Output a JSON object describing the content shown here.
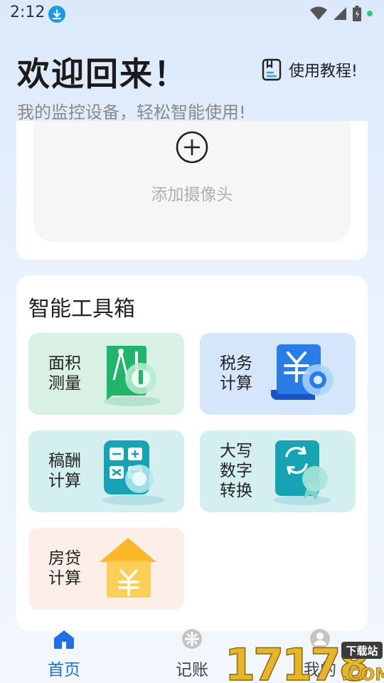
{
  "status_bar": {
    "time": "2:12",
    "icons": [
      "download-icon",
      "wifi-icon",
      "signal-icon",
      "battery-icon",
      "notification-dot-icon"
    ]
  },
  "header": {
    "title": "欢迎回来！",
    "subtitle": "我的监控设备，轻松智能使用!",
    "tutorial_label": "使用教程!"
  },
  "camera": {
    "add_label": "添加摄像头"
  },
  "toolbox": {
    "title": "智能工具箱",
    "tools": [
      {
        "lines": [
          "面积",
          "测量"
        ],
        "icon": "ruler-compass-icon"
      },
      {
        "lines": [
          "税务",
          "计算"
        ],
        "icon": "yuan-document-icon"
      },
      {
        "lines": [
          "稿酬",
          "计算"
        ],
        "icon": "calculator-icon"
      },
      {
        "lines": [
          "大写",
          "数字",
          "转换"
        ],
        "icon": "certificate-icon"
      },
      {
        "lines": [
          "房贷",
          "计算"
        ],
        "icon": "house-yuan-icon"
      }
    ]
  },
  "nav": {
    "items": [
      {
        "label": "首页",
        "icon": "home-icon"
      },
      {
        "label": "记账",
        "icon": "ledger-icon"
      },
      {
        "label": "我的",
        "icon": "user-icon"
      }
    ]
  },
  "watermark": {
    "brand": "17178",
    "tag": "下载站",
    "suffix": ".COM"
  },
  "colors": {
    "accent": "#1e6fe8",
    "green_tile": "#d8f1e4",
    "blue_tile": "#d5e6fa",
    "teal_tile": "#d3efef",
    "peach_tile": "#fdeee8"
  }
}
